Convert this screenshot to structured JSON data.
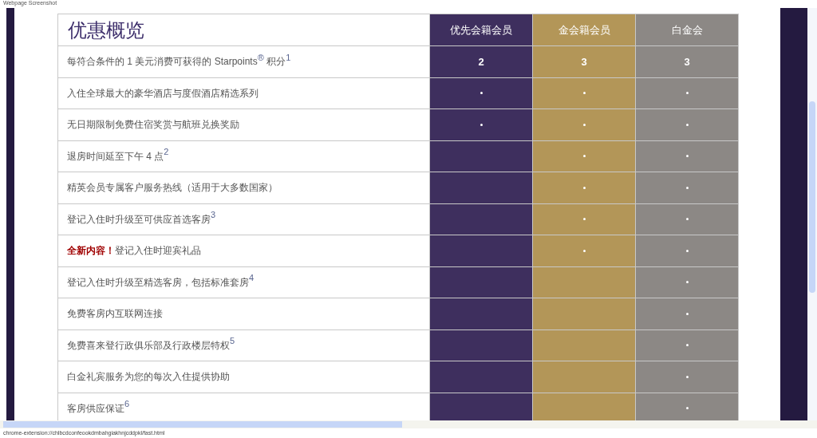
{
  "caption": "Webpage Screenshot",
  "table": {
    "title": "优惠概览",
    "columns": [
      {
        "label": "优先会籍会员",
        "color": "#3e2f5e"
      },
      {
        "label": "金会籍会员",
        "color": "#b39658"
      },
      {
        "label": "白金会",
        "color": "#8c8885"
      }
    ],
    "rows": [
      {
        "label": "每符合条件的 1 美元消费可获得的 Starpoints$^{®}$ 积分$^{1}$",
        "cells": [
          {
            "kind": "text",
            "text": "2"
          },
          {
            "kind": "text",
            "text": "3"
          },
          {
            "kind": "text",
            "text": "3"
          }
        ]
      },
      {
        "label": "入住全球最大的豪华酒店与度假酒店精选系列",
        "cells": [
          {
            "kind": "dot",
            "on": true
          },
          {
            "kind": "dot",
            "on": true
          },
          {
            "kind": "dot",
            "on": true
          }
        ]
      },
      {
        "label": "无日期限制免费住宿奖赏与航班兑换奖励",
        "cells": [
          {
            "kind": "dot",
            "on": true
          },
          {
            "kind": "dot",
            "on": true
          },
          {
            "kind": "dot",
            "on": true
          }
        ]
      },
      {
        "label": "退房时间延至下午 4 点$^{2}$",
        "cells": [
          {
            "kind": "dot",
            "on": false
          },
          {
            "kind": "dot",
            "on": true
          },
          {
            "kind": "dot",
            "on": true
          }
        ]
      },
      {
        "label": "精英会员专属客户服务热线（适用于大多数国家）",
        "cells": [
          {
            "kind": "dot",
            "on": false
          },
          {
            "kind": "dot",
            "on": true
          },
          {
            "kind": "dot",
            "on": true
          }
        ]
      },
      {
        "label": "登记入住时升级至可供应首选客房$^{3}$",
        "cells": [
          {
            "kind": "dot",
            "on": false
          },
          {
            "kind": "dot",
            "on": true
          },
          {
            "kind": "dot",
            "on": true
          }
        ]
      },
      {
        "label": "**全新内容！**登记入住时迎宾礼品",
        "cells": [
          {
            "kind": "dot",
            "on": false
          },
          {
            "kind": "dot",
            "on": true
          },
          {
            "kind": "dot",
            "on": true
          }
        ]
      },
      {
        "label": "登记入住时升级至精选客房，包括标准套房$^{4}$",
        "cells": [
          {
            "kind": "dot",
            "on": false
          },
          {
            "kind": "dot",
            "on": false
          },
          {
            "kind": "dot",
            "on": true
          }
        ]
      },
      {
        "label": "免费客房内互联网连接",
        "cells": [
          {
            "kind": "dot",
            "on": false
          },
          {
            "kind": "dot",
            "on": false
          },
          {
            "kind": "dot",
            "on": true
          }
        ]
      },
      {
        "label": "免费喜来登行政俱乐部及行政楼层特权$^{5}$",
        "cells": [
          {
            "kind": "dot",
            "on": false
          },
          {
            "kind": "dot",
            "on": false
          },
          {
            "kind": "dot",
            "on": true
          }
        ]
      },
      {
        "label": "白金礼宾服务为您的每次入住提供协助",
        "cells": [
          {
            "kind": "dot",
            "on": false
          },
          {
            "kind": "dot",
            "on": false
          },
          {
            "kind": "dot",
            "on": true
          }
        ]
      },
      {
        "label": "客房供应保证$^{6}$",
        "cells": [
          {
            "kind": "dot",
            "on": false
          },
          {
            "kind": "dot",
            "on": false
          },
          {
            "kind": "dot",
            "on": true
          }
        ]
      }
    ]
  },
  "status_bar": "chrome-extension://chlbcdconfeookdmbahgiakhnjcddpkl/fast.html"
}
